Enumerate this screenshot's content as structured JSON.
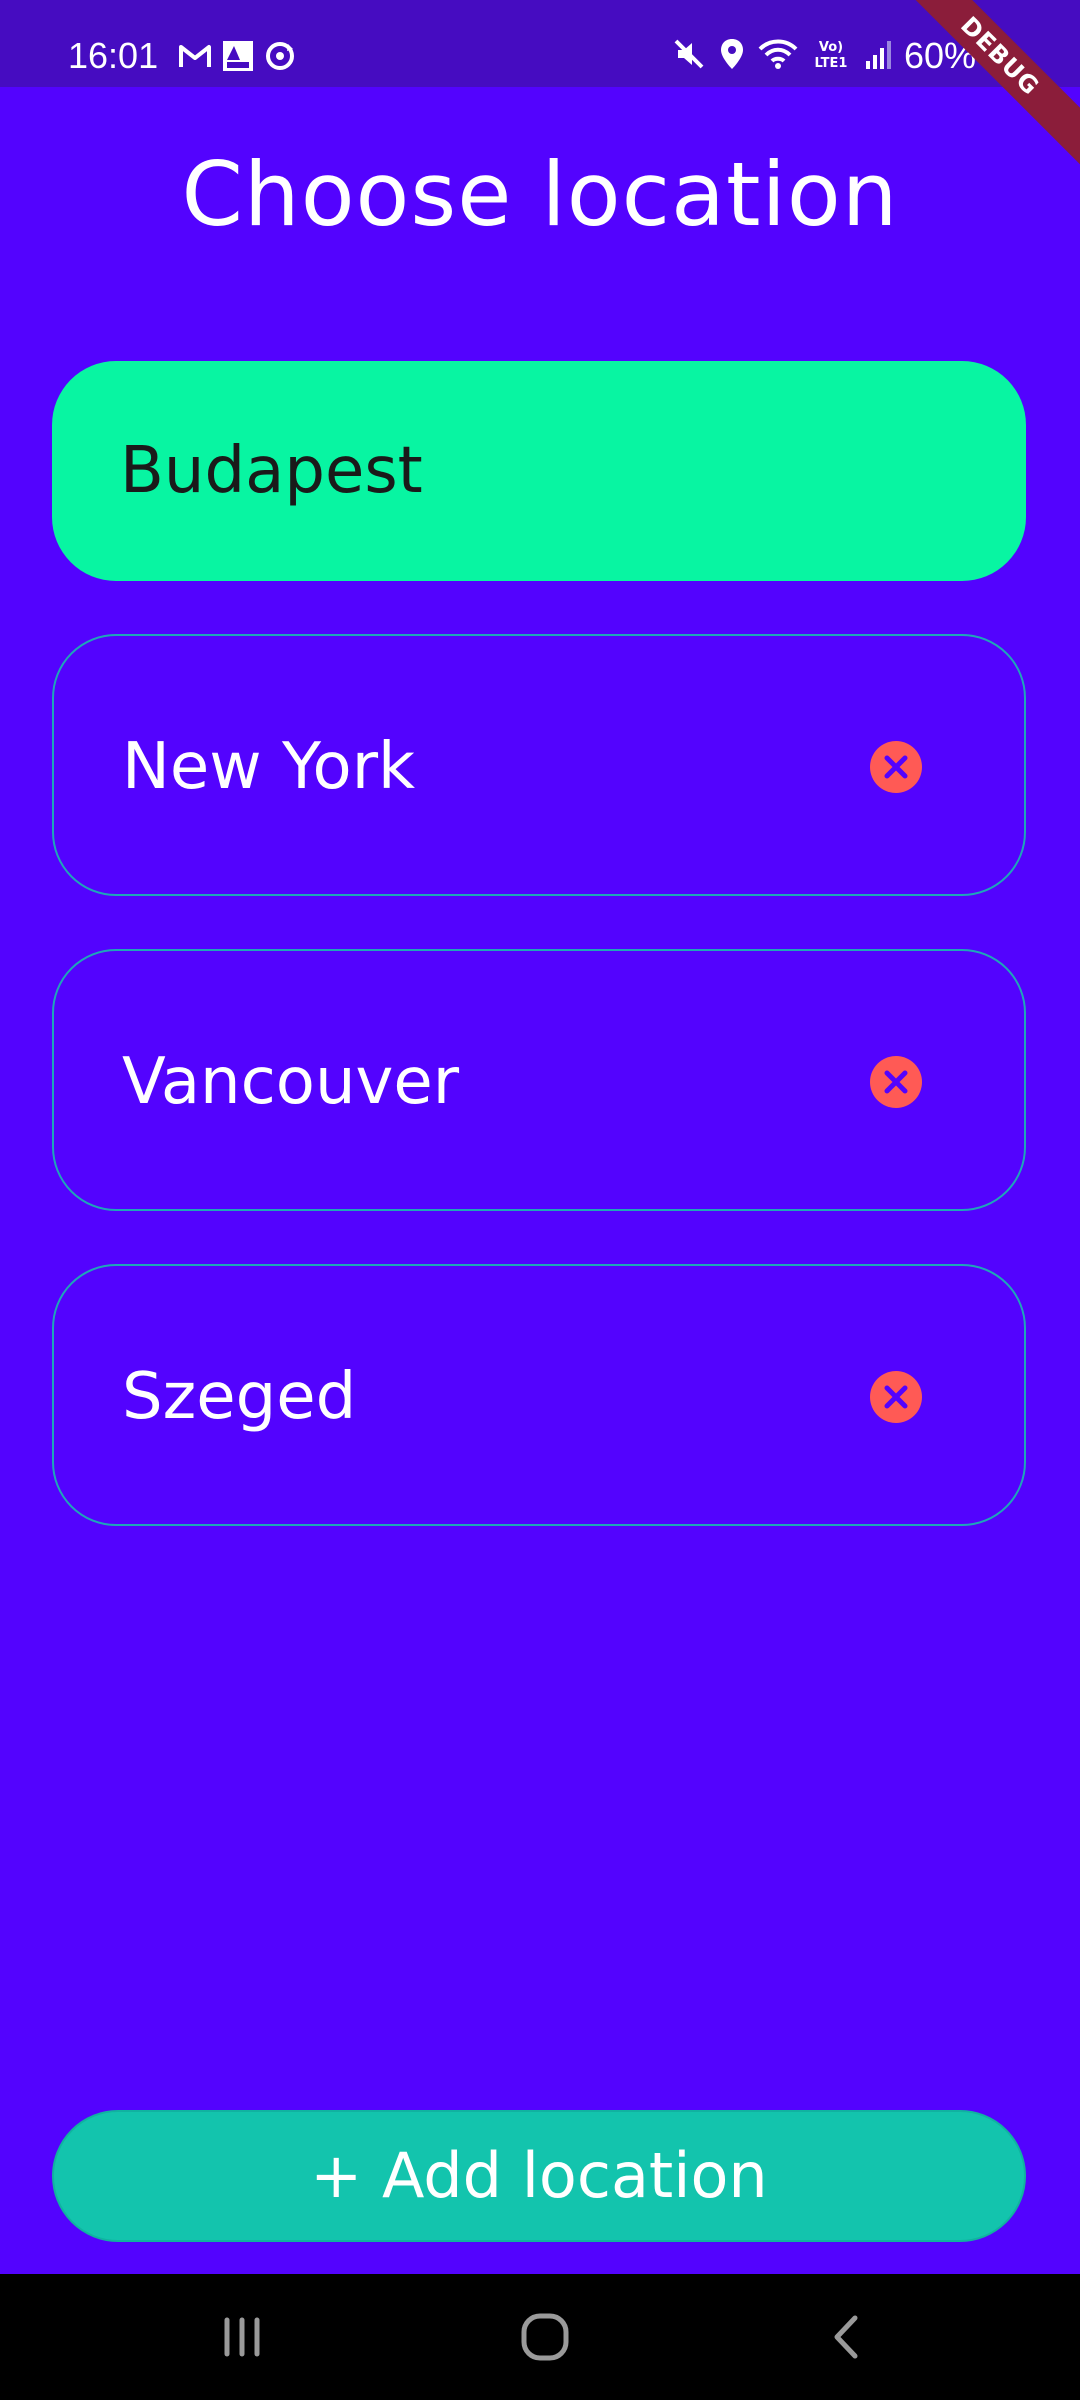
{
  "status_bar": {
    "time": "16:01",
    "battery_percent": "60%",
    "left_icons": [
      "gmail-icon",
      "aldi-icon",
      "sync-icon"
    ],
    "right_icons": [
      "mute-icon",
      "location-pin-icon",
      "wifi-icon",
      "volte-icon",
      "signal-icon",
      "battery-icon"
    ]
  },
  "debug_banner": "DEBUG",
  "page": {
    "title": "Choose location"
  },
  "locations": [
    {
      "name": "Budapest",
      "selected": true
    },
    {
      "name": "New York",
      "selected": false
    },
    {
      "name": "Vancouver",
      "selected": false
    },
    {
      "name": "Szeged",
      "selected": false
    }
  ],
  "add_button": {
    "label": "+ Add location"
  },
  "colors": {
    "background": "#5303fe",
    "status_bar": "#460cc1",
    "selected_card": "#08f5a2",
    "card_border": "#1fa6b8",
    "remove_button": "#ff5a55",
    "add_button": "#13c4ad"
  },
  "nav_bar": {
    "buttons": [
      "recent-apps-icon",
      "home-icon",
      "back-icon"
    ]
  }
}
